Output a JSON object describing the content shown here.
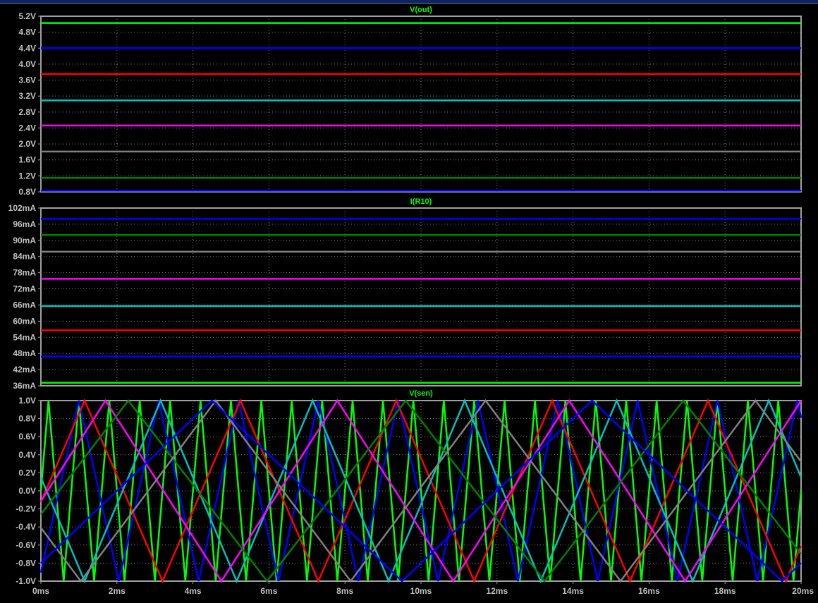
{
  "chart_data": [
    {
      "type": "line",
      "title": "V(out)",
      "x_unit": "ms",
      "y_unit": "V",
      "xlim": [
        0,
        20
      ],
      "ylim": [
        0.8,
        5.2
      ],
      "y_ticks": [
        "5.2V",
        "4.8V",
        "4.4V",
        "4.0V",
        "3.6V",
        "3.2V",
        "2.8V",
        "2.4V",
        "2.0V",
        "1.6V",
        "1.2V",
        "0.8V"
      ],
      "y_tick_values": [
        5.2,
        4.8,
        4.4,
        4.0,
        3.6,
        3.2,
        2.8,
        2.4,
        2.0,
        1.6,
        1.2,
        0.8
      ],
      "grid": true,
      "series": [
        {
          "color": "#00ff00",
          "y": 5.03
        },
        {
          "color": "#0000ff",
          "y": 4.4
        },
        {
          "color": "#ff0000",
          "y": 3.75
        },
        {
          "color": "#00c0c0",
          "y": 3.09
        },
        {
          "color": "#ff00ff",
          "y": 2.46
        },
        {
          "color": "#808080",
          "y": 1.81
        },
        {
          "color": "#008000",
          "y": 1.15
        },
        {
          "color": "#0000ff",
          "y": 0.83
        }
      ]
    },
    {
      "type": "line",
      "title": "I(R10)",
      "x_unit": "ms",
      "y_unit": "mA",
      "xlim": [
        0,
        20
      ],
      "ylim": [
        36,
        102
      ],
      "y_ticks": [
        "102mA",
        "96mA",
        "90mA",
        "84mA",
        "78mA",
        "72mA",
        "66mA",
        "60mA",
        "54mA",
        "48mA",
        "42mA",
        "36mA"
      ],
      "y_tick_values": [
        102,
        96,
        90,
        84,
        78,
        72,
        66,
        60,
        54,
        48,
        42,
        36
      ],
      "grid": true,
      "series": [
        {
          "color": "#0000ff",
          "y": 98.0
        },
        {
          "color": "#008000",
          "y": 92.0
        },
        {
          "color": "#808080",
          "y": 85.8
        },
        {
          "color": "#ff00ff",
          "y": 75.7
        },
        {
          "color": "#00c0c0",
          "y": 65.6
        },
        {
          "color": "#ff0000",
          "y": 56.6
        },
        {
          "color": "#0000ff",
          "y": 46.9
        },
        {
          "color": "#00ff00",
          "y": 37.1
        }
      ]
    },
    {
      "type": "line",
      "title": "V(sen)",
      "x_unit": "ms",
      "y_unit": "V",
      "xlim": [
        0,
        20
      ],
      "ylim": [
        -1.0,
        1.0
      ],
      "x_ticks": [
        "0ms",
        "2ms",
        "4ms",
        "6ms",
        "8ms",
        "10ms",
        "12ms",
        "14ms",
        "16ms",
        "18ms",
        "20ms"
      ],
      "x_tick_values": [
        0,
        2,
        4,
        6,
        8,
        10,
        12,
        14,
        16,
        18,
        20
      ],
      "y_ticks": [
        "1.0V",
        "0.8V",
        "0.6V",
        "0.4V",
        "0.2V",
        "0.0V",
        "-0.2V",
        "-0.4V",
        "-0.6V",
        "-0.8V",
        "-1.0V"
      ],
      "y_tick_values": [
        1.0,
        0.8,
        0.6,
        0.4,
        0.2,
        0.0,
        -0.2,
        -0.4,
        -0.6,
        -0.8,
        -1.0
      ],
      "grid": true,
      "waveform": "triangle",
      "series": [
        {
          "color": "#00ff00",
          "period": 0.8,
          "first_peak": 0.2
        },
        {
          "color": "#0000ff",
          "period": 2.1,
          "first_peak": 1.0
        },
        {
          "color": "#ff0000",
          "period": 4.1,
          "first_peak": 1.15
        },
        {
          "color": "#00c0c0",
          "period": 4.0,
          "first_peak": 3.15
        },
        {
          "color": "#ff00ff",
          "period": 6.1,
          "first_peak": 1.7
        },
        {
          "color": "#008000",
          "period": 7.3,
          "first_peak": 2.3
        },
        {
          "color": "#808080",
          "period": 7.1,
          "first_peak": 4.6
        },
        {
          "color": "#0000ff",
          "period": 10.0,
          "first_peak": 4.5
        }
      ]
    }
  ]
}
